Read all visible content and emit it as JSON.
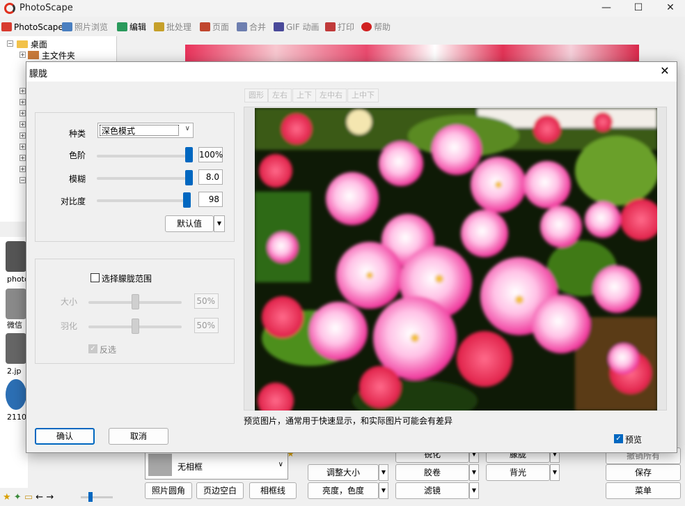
{
  "app": {
    "title": "PhotoScape"
  },
  "window_controls": {
    "minimize": "—",
    "maximize": "☐",
    "close": "✕"
  },
  "tabs": [
    {
      "label": "PhotoScape",
      "active": true,
      "color": "#d83b2f"
    },
    {
      "label": "照片浏览",
      "active": false,
      "color": "#4a7fc0"
    },
    {
      "label": "编辑",
      "active": true,
      "color": "#2a9a5c"
    },
    {
      "label": "批处理",
      "active": false,
      "color": "#c6a02a"
    },
    {
      "label": "页面",
      "active": false,
      "color": "#c0462e"
    },
    {
      "label": "合并",
      "active": false,
      "color": "#6e7fb0"
    },
    {
      "label": "GIF 动画",
      "active": false,
      "color": "#4a4a9a"
    },
    {
      "label": "打印",
      "active": false,
      "color": "#c03a3a"
    },
    {
      "label": "帮助",
      "active": false,
      "color": "#d02020"
    }
  ],
  "tree": {
    "root": "桌面",
    "child": "主文件夹",
    "expanders": 12
  },
  "thumbnails": [
    "photo",
    "微信",
    "2.jp",
    "2110"
  ],
  "bottom_tools": {
    "frame": "无相框",
    "buttons_row1": [
      "照片圆角",
      "页边空白",
      "相框线"
    ],
    "mid_col1": [
      "调整大小",
      "亮度，色度"
    ],
    "mid_col2": [
      "锐化",
      "胶卷",
      "滤镜"
    ],
    "mid_col3": [
      "朦胧",
      "背光"
    ],
    "right": [
      "撤销所有",
      "保存",
      "菜单"
    ]
  },
  "dialog": {
    "title": "朦胧",
    "close": "✕",
    "type_label": "种类",
    "type_value": "深色模式",
    "level_label": "色阶",
    "level_value": "100%",
    "level_fraction": 1.0,
    "blur_label": "模糊",
    "blur_value": "8.0",
    "blur_fraction": 1.0,
    "contrast_label": "对比度",
    "contrast_value": "98",
    "contrast_fraction": 0.98,
    "default_button": "默认值",
    "range_checkbox": "选择朦胧范围",
    "size_label": "大小",
    "size_value": "50%",
    "feather_label": "羽化",
    "feather_value": "50%",
    "invert_label": "反选",
    "shape_tabs": [
      "圆形",
      "左右",
      "上下",
      "左中右",
      "上中下"
    ],
    "preview_note": "预览图片，通常用于快速显示，和实际图片可能会有差异",
    "preview_checkbox": "预览",
    "ok": "确认",
    "cancel": "取消"
  },
  "colors": {
    "accent": "#0067c0"
  }
}
